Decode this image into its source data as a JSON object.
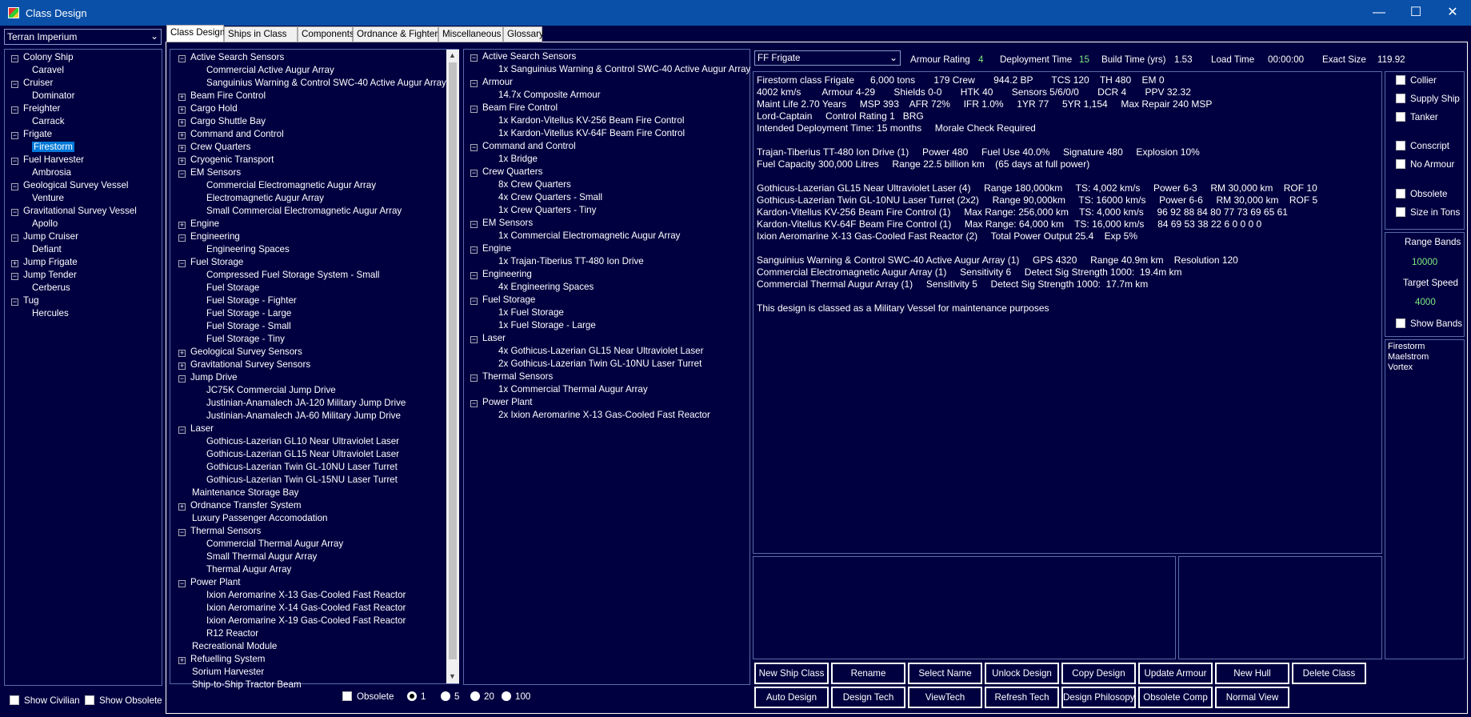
{
  "window": {
    "title": "Class Design"
  },
  "race_selector": {
    "value": "Terran Imperium"
  },
  "class_tree": [
    {
      "label": "Colony Ship",
      "expanded": true,
      "children": [
        "Caravel"
      ]
    },
    {
      "label": "Cruiser",
      "expanded": true,
      "children": [
        "Dominator"
      ]
    },
    {
      "label": "Freighter",
      "expanded": true,
      "children": [
        "Carrack"
      ]
    },
    {
      "label": "Frigate",
      "expanded": true,
      "children": [
        "Firestorm"
      ]
    },
    {
      "label": "Fuel Harvester",
      "expanded": true,
      "children": [
        "Ambrosia"
      ]
    },
    {
      "label": "Geological Survey Vessel",
      "expanded": true,
      "children": [
        "Venture"
      ]
    },
    {
      "label": "Gravitational Survey Vessel",
      "expanded": true,
      "children": [
        "Apollo"
      ]
    },
    {
      "label": "Jump Cruiser",
      "expanded": true,
      "children": [
        "Defiant"
      ]
    },
    {
      "label": "Jump Frigate",
      "expanded": false,
      "children": []
    },
    {
      "label": "Jump Tender",
      "expanded": true,
      "children": [
        "Cerberus"
      ]
    },
    {
      "label": "Tug",
      "expanded": true,
      "children": [
        "Hercules"
      ]
    }
  ],
  "selected_class": "Firestorm",
  "left_checkboxes": {
    "show_civilian": "Show Civilian",
    "show_obsolete": "Show Obsolete"
  },
  "tabs": [
    "Class Design",
    "Ships in Class",
    "Components",
    "Ordnance & Fighters",
    "Miscellaneous",
    "Glossary"
  ],
  "component_tree": [
    {
      "label": "Active Search Sensors",
      "expanded": true,
      "children": [
        "Commercial Active Augur Array",
        "Sanguinius Warning & Control SWC-40 Active Augur Array"
      ]
    },
    {
      "label": "Beam Fire Control",
      "expanded": false,
      "children": []
    },
    {
      "label": "Cargo Hold",
      "expanded": false,
      "children": []
    },
    {
      "label": "Cargo Shuttle Bay",
      "expanded": false,
      "children": []
    },
    {
      "label": "Command and Control",
      "expanded": false,
      "children": []
    },
    {
      "label": "Crew Quarters",
      "expanded": false,
      "children": []
    },
    {
      "label": "Cryogenic Transport",
      "expanded": false,
      "children": []
    },
    {
      "label": "EM Sensors",
      "expanded": true,
      "children": [
        "Commercial Electromagnetic Augur Array",
        "Electromagnetic Augur Array",
        "Small Commercial Electromagnetic Augur Array"
      ]
    },
    {
      "label": "Engine",
      "expanded": false,
      "children": []
    },
    {
      "label": "Engineering",
      "expanded": true,
      "children": [
        "Engineering Spaces"
      ]
    },
    {
      "label": "Fuel Storage",
      "expanded": true,
      "children": [
        "Compressed Fuel Storage System - Small",
        "Fuel Storage",
        "Fuel Storage - Fighter",
        "Fuel Storage - Large",
        "Fuel Storage - Small",
        "Fuel Storage - Tiny"
      ]
    },
    {
      "label": "Geological Survey Sensors",
      "expanded": false,
      "children": []
    },
    {
      "label": "Gravitational Survey Sensors",
      "expanded": false,
      "children": []
    },
    {
      "label": "Jump Drive",
      "expanded": true,
      "children": [
        "JC75K Commercial Jump Drive",
        "Justinian-Anamalech JA-120 Military Jump Drive",
        "Justinian-Anamalech JA-60 Military Jump Drive"
      ]
    },
    {
      "label": "Laser",
      "expanded": true,
      "children": [
        "Gothicus-Lazerian GL10 Near Ultraviolet Laser",
        "Gothicus-Lazerian GL15 Near Ultraviolet Laser",
        "Gothicus-Lazerian Twin GL-10NU Laser Turret",
        "Gothicus-Lazerian Twin GL-15NU Laser Turret"
      ]
    },
    {
      "label": "Maintenance Storage Bay",
      "leaf": true,
      "children": []
    },
    {
      "label": "Ordnance Transfer System",
      "expanded": false,
      "children": []
    },
    {
      "label": "Luxury Passenger Accomodation",
      "leaf": true,
      "children": []
    },
    {
      "label": "Thermal Sensors",
      "expanded": true,
      "children": [
        "Commercial Thermal Augur Array",
        "Small Thermal Augur Array",
        "Thermal Augur Array"
      ]
    },
    {
      "label": "Power Plant",
      "expanded": true,
      "children": [
        "Ixion Aeromarine X-13 Gas-Cooled Fast Reactor",
        "Ixion Aeromarine X-14 Gas-Cooled Fast Reactor",
        "Ixion Aeromarine X-19 Gas-Cooled Fast Reactor",
        "R12 Reactor"
      ]
    },
    {
      "label": "Recreational Module",
      "leaf": true,
      "children": []
    },
    {
      "label": "Refuelling System",
      "expanded": false,
      "children": []
    },
    {
      "label": "Sorium Harvester",
      "leaf": true,
      "children": []
    },
    {
      "label": "Ship-to-Ship Tractor Beam",
      "leaf": true,
      "children": []
    }
  ],
  "design_tree": [
    {
      "label": "Active Search Sensors",
      "children": [
        "1x Sanguinius Warning & Control SWC-40 Active Augur Array"
      ]
    },
    {
      "label": "Armour",
      "children": [
        "14.7x Composite Armour"
      ]
    },
    {
      "label": "Beam Fire Control",
      "children": [
        "1x Kardon-Vitellus KV-256 Beam Fire Control",
        "1x Kardon-Vitellus KV-64F Beam Fire Control"
      ]
    },
    {
      "label": "Command and Control",
      "children": [
        "1x Bridge"
      ]
    },
    {
      "label": "Crew Quarters",
      "children": [
        "8x Crew Quarters",
        "4x Crew Quarters - Small",
        "1x Crew Quarters - Tiny"
      ]
    },
    {
      "label": "EM Sensors",
      "children": [
        "1x Commercial Electromagnetic Augur Array"
      ]
    },
    {
      "label": "Engine",
      "children": [
        "1x Trajan-Tiberius TT-480 Ion Drive"
      ]
    },
    {
      "label": "Engineering",
      "children": [
        "4x Engineering Spaces"
      ]
    },
    {
      "label": "Fuel Storage",
      "children": [
        "1x Fuel Storage",
        "1x Fuel Storage - Large"
      ]
    },
    {
      "label": "Laser",
      "children": [
        "4x Gothicus-Lazerian GL15 Near Ultraviolet Laser",
        "2x Gothicus-Lazerian Twin GL-10NU Laser Turret"
      ]
    },
    {
      "label": "Thermal Sensors",
      "children": [
        "1x Commercial Thermal Augur Array"
      ]
    },
    {
      "label": "Power Plant",
      "children": [
        "2x Ixion Aeromarine X-13 Gas-Cooled Fast Reactor"
      ]
    }
  ],
  "bottom_options": {
    "obsolete": "Obsolete",
    "radios": [
      "1",
      "5",
      "20",
      "100"
    ],
    "selected_radio": "1"
  },
  "header": {
    "hull_type": "FF Frigate",
    "armour_rating_label": "Armour Rating",
    "armour_rating": "4",
    "deployment_time_label": "Deployment Time",
    "deployment_time": "15",
    "build_time_label": "Build Time (yrs)",
    "build_time": "1.53",
    "load_time_label": "Load Time",
    "load_time": "00:00:00",
    "exact_size_label": "Exact Size",
    "exact_size": "119.92"
  },
  "summary_lines": [
    "Firestorm class Frigate      6,000 tons       179 Crew       944.2 BP       TCS 120    TH 480    EM 0",
    "4002 km/s        Armour 4-29       Shields 0-0       HTK 40       Sensors 5/6/0/0       DCR 4       PPV 32.32",
    "Maint Life 2.70 Years     MSP 393    AFR 72%     IFR 1.0%     1YR 77     5YR 1,154     Max Repair 240 MSP",
    "Lord-Captain     Control Rating 1   BRG",
    "Intended Deployment Time: 15 months     Morale Check Required",
    "",
    "Trajan-Tiberius TT-480 Ion Drive (1)     Power 480     Fuel Use 40.0%     Signature 480     Explosion 10%",
    "Fuel Capacity 300,000 Litres     Range 22.5 billion km    (65 days at full power)",
    "",
    "Gothicus-Lazerian GL15 Near Ultraviolet Laser (4)     Range 180,000km     TS: 4,002 km/s     Power 6-3     RM 30,000 km    ROF 10",
    "Gothicus-Lazerian Twin GL-10NU Laser Turret (2x2)     Range 90,000km     TS: 16000 km/s     Power 6-6     RM 30,000 km    ROF 5",
    "Kardon-Vitellus KV-256 Beam Fire Control (1)     Max Range: 256,000 km    TS: 4,000 km/s     96 92 88 84 80 77 73 69 65 61",
    "Kardon-Vitellus KV-64F Beam Fire Control (1)     Max Range: 64,000 km    TS: 16,000 km/s     84 69 53 38 22 6 0 0 0 0",
    "Ixion Aeromarine X-13 Gas-Cooled Fast Reactor (2)     Total Power Output 25.4    Exp 5%",
    "",
    "Sanguinius Warning & Control SWC-40 Active Augur Array (1)     GPS 4320     Range 40.9m km    Resolution 120",
    "Commercial Electromagnetic Augur Array (1)     Sensitivity 6     Detect Sig Strength 1000:  19.4m km",
    "Commercial Thermal Augur Array (1)     Sensitivity 5     Detect Sig Strength 1000:  17.7m km",
    "",
    "This design is classed as a Military Vessel for maintenance purposes"
  ],
  "right_options": [
    "Collier",
    "Supply Ship",
    "Tanker",
    "Conscript",
    "No Armour",
    "Obsolete",
    "Size in Tons"
  ],
  "range_panel": {
    "range_bands_label": "Range Bands",
    "range_bands": "10000",
    "target_speed_label": "Target Speed",
    "target_speed": "4000",
    "show_bands": "Show Bands"
  },
  "name_list": [
    "Firestorm",
    "Maelstrom",
    "Vortex"
  ],
  "buttons_row1": [
    "New Ship Class",
    "Rename",
    "Select Name",
    "Unlock Design",
    "Copy Design",
    "Update Armour",
    "New Hull",
    "Delete Class"
  ],
  "buttons_row2": [
    "Auto Design",
    "Design Tech",
    "ViewTech",
    "Refresh Tech",
    "Design Philosopy",
    "Obsolete Comp",
    "Normal View"
  ]
}
